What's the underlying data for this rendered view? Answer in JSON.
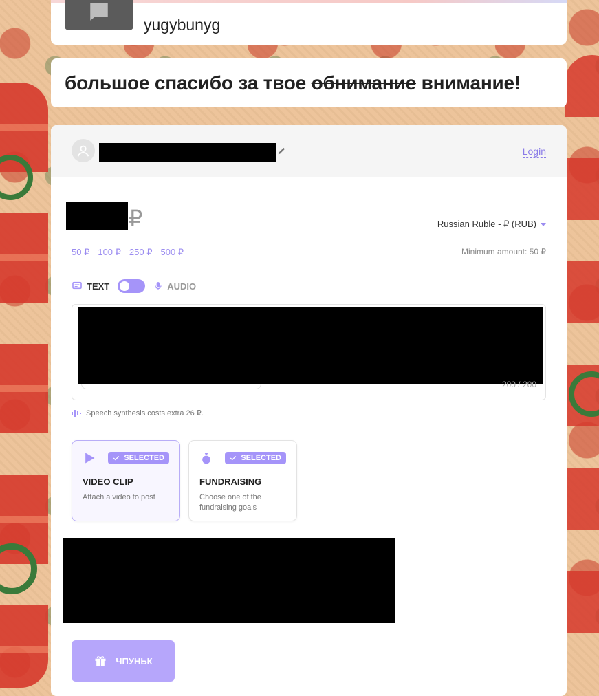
{
  "profile": {
    "username": "yugybunyg"
  },
  "thanks": {
    "before": "большое спасибо за твое ",
    "struck": "обнимание",
    "after": " внимание!"
  },
  "header": {
    "login_label": "Login"
  },
  "amount": {
    "currency_symbol": "₽",
    "currency_selected": "Russian Ruble - ₽ (RUB)",
    "presets": [
      "50 ₽",
      "100 ₽",
      "250 ₽",
      "500 ₽"
    ],
    "minimum_label": "Minimum amount: 50 ₽"
  },
  "mode": {
    "text_label": "TEXT",
    "audio_label": "AUDIO"
  },
  "message": {
    "char_count": "200 / 200"
  },
  "synthesis_note": "Speech synthesis costs extra 26 ₽.",
  "options": [
    {
      "badge": "SELECTED",
      "title": "VIDEO CLIP",
      "description": "Attach a video to post"
    },
    {
      "badge": "SELECTED",
      "title": "FUNDRAISING",
      "description": "Choose one of the fundraising goals"
    }
  ],
  "submit": {
    "label": "ЧПУНЬК"
  },
  "colors": {
    "accent": "#a594f9",
    "background": "#edc49b",
    "red_pattern": "#d6392c",
    "green_pattern": "#3a7a3a"
  }
}
